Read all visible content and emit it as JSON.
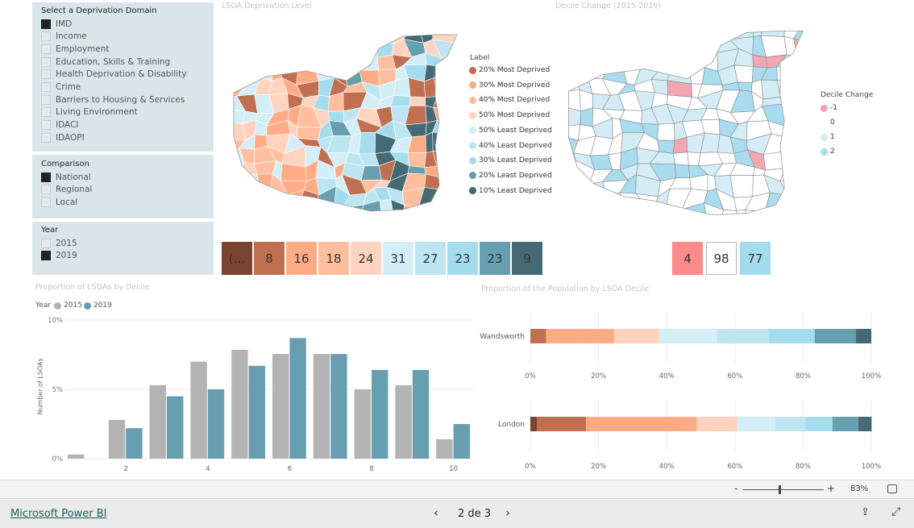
{
  "slicers": {
    "domain": {
      "title": "Select a Deprivation Domain",
      "options": [
        {
          "label": "IMD",
          "checked": true
        },
        {
          "label": "Income",
          "checked": false
        },
        {
          "label": "Employment",
          "checked": false
        },
        {
          "label": "Education, Skills & Training",
          "checked": false
        },
        {
          "label": "Health Deprivation & Disability",
          "checked": false
        },
        {
          "label": "Crime",
          "checked": false
        },
        {
          "label": "Barriers to Housing & Services",
          "checked": false
        },
        {
          "label": "Living Environment",
          "checked": false
        },
        {
          "label": "IDACI",
          "checked": false
        },
        {
          "label": "IDAOPI",
          "checked": false
        }
      ]
    },
    "comparison": {
      "title": "Comparison",
      "options": [
        {
          "label": "National",
          "checked": true
        },
        {
          "label": "Regional",
          "checked": false
        },
        {
          "label": "Local",
          "checked": false
        }
      ]
    },
    "year": {
      "title": "Year",
      "options": [
        {
          "label": "2015",
          "checked": false
        },
        {
          "label": "2019",
          "checked": true
        }
      ]
    }
  },
  "map_level": {
    "title": "LSOA Deprivation Level",
    "legend_title": "Label",
    "legend": [
      {
        "label": "20% Most Deprived",
        "color": "#c07050"
      },
      {
        "label": "30% Most Deprived",
        "color": "#ffab85"
      },
      {
        "label": "40% Most Deprived",
        "color": "#ffbf9f"
      },
      {
        "label": "50% Most Deprived",
        "color": "#ffd3c0"
      },
      {
        "label": "50% Least Deprived",
        "color": "#d3eef7"
      },
      {
        "label": "40% Least Deprived",
        "color": "#bce5f1"
      },
      {
        "label": "30% Least Deprived",
        "color": "#a4dcee"
      },
      {
        "label": "20% Least Deprived",
        "color": "#679fb0"
      },
      {
        "label": "10% Least Deprived",
        "color": "#456a75"
      }
    ]
  },
  "map_change": {
    "title": "Decile Change (2015-2019)",
    "legend_title": "Decile Change",
    "legend": [
      {
        "label": "-1",
        "color": "#f4a6b0"
      },
      {
        "label": "0",
        "color": "#ffffff"
      },
      {
        "label": "1",
        "color": "#d3ecf5"
      },
      {
        "label": "2",
        "color": "#a8dcee"
      }
    ]
  },
  "decile_cards": [
    {
      "value": "(...",
      "color": "#7a4530"
    },
    {
      "value": "8",
      "color": "#c07050"
    },
    {
      "value": "16",
      "color": "#ffab85"
    },
    {
      "value": "18",
      "color": "#ffbf9f"
    },
    {
      "value": "24",
      "color": "#ffd3c0"
    },
    {
      "value": "31",
      "color": "#d3eef7"
    },
    {
      "value": "27",
      "color": "#bce5f1"
    },
    {
      "value": "23",
      "color": "#a4dcee"
    },
    {
      "value": "23",
      "color": "#679fb0"
    },
    {
      "value": "9",
      "color": "#456a75"
    }
  ],
  "change_cards": [
    {
      "value": "4",
      "color": "#ff8a8a"
    },
    {
      "value": "98",
      "color": "#ffffff"
    },
    {
      "value": "77",
      "color": "#a4dcee"
    }
  ],
  "chart_data": [
    {
      "type": "bar",
      "title": "Proportion of LSOAs by Decile",
      "ylabel": "Number of LSOAs",
      "legend_title": "Year",
      "legend": "top-left",
      "categories": [
        1,
        2,
        3,
        4,
        5,
        6,
        7,
        8,
        9,
        10
      ],
      "x_tick_labels": [
        "2",
        "4",
        "6",
        "8",
        "10"
      ],
      "y_tick_labels": [
        "0%",
        "5%",
        "10%"
      ],
      "ylim": [
        0,
        10
      ],
      "grid": true,
      "series": [
        {
          "name": "2015",
          "color": "#b3b3b3",
          "values": [
            0.3,
            2.8,
            5.3,
            7.0,
            7.85,
            7.55,
            7.55,
            5.0,
            5.3,
            1.4
          ]
        },
        {
          "name": "2019",
          "color": "#679fb0",
          "values": [
            0,
            2.2,
            4.5,
            5.0,
            6.7,
            8.7,
            7.55,
            6.4,
            6.4,
            2.5
          ]
        }
      ]
    },
    {
      "type": "bar",
      "orientation": "horizontal",
      "stacked": true,
      "title": "Proportion of the Population by LSOA Decile",
      "categories": [
        "Wandsworth",
        "London"
      ],
      "x_tick_labels": [
        "0%",
        "20%",
        "40%",
        "60%",
        "80%",
        "100%"
      ],
      "xlim": [
        0,
        100
      ],
      "colors": [
        "#7a4530",
        "#c07050",
        "#ffab85",
        "#ffab85",
        "#ffd3c0",
        "#d3eef7",
        "#bce5f1",
        "#a4dcee",
        "#679fb0",
        "#456a75"
      ],
      "series_values": {
        "Wandsworth": [
          0,
          4.6,
          9.2,
          10.8,
          13.3,
          16.9,
          15.3,
          13.3,
          12.1,
          4.5
        ],
        "London": [
          1.9,
          14.4,
          18.1,
          14.4,
          11.9,
          11.0,
          9.0,
          7.9,
          7.6,
          3.9
        ]
      }
    }
  ],
  "zoom": {
    "minus": "-",
    "plus": "+",
    "value": "83%",
    "level": 0.45
  },
  "footer": {
    "brand": "Microsoft Power BI",
    "page": "2 de 3"
  }
}
